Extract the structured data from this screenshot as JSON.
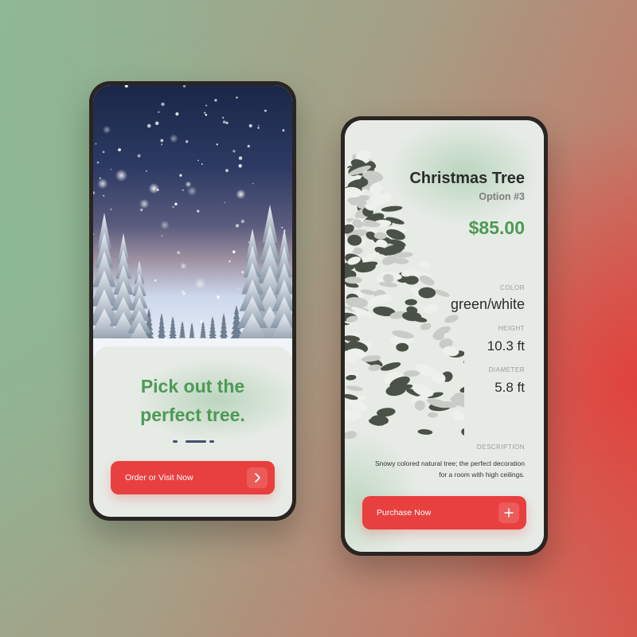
{
  "onboarding_screen": {
    "headline_line1": "Pick out the",
    "headline_line2": "perfect tree.",
    "pager": {
      "pages": 3,
      "active_index": 1
    },
    "cta_label": "Order or Visit Now",
    "cta_icon": "chevron-right-icon"
  },
  "product_screen": {
    "title": "Christmas Tree",
    "option": "Option #3",
    "price": "$85.00",
    "color_label": "COLOR",
    "color_value": "green/white",
    "height_label": "HEIGHT",
    "height_value": "10.3 ft",
    "diameter_label": "DIAMETER",
    "diameter_value": "5.8 ft",
    "description_label": "DESCRIPTION",
    "description": "Snowy colored natural tree; the perfect decoration for a room with high ceilings.",
    "cta_label": "Purchase Now",
    "cta_icon": "plus-icon"
  },
  "colors": {
    "accent_red": "#e8403f",
    "accent_green": "#4c9a55",
    "text_dark": "#2b2b2b",
    "card_bg": "#e7ebe6",
    "phone_frame": "#2a2422"
  }
}
